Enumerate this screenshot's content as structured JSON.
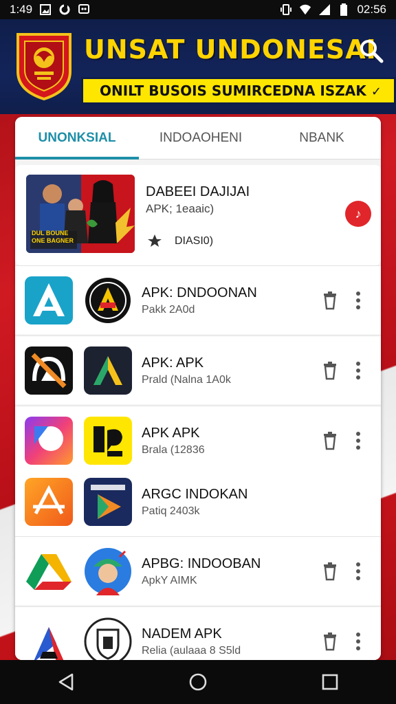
{
  "status_bar": {
    "time_left": "1:49",
    "time_right": "02:56"
  },
  "header": {
    "title": "UNSAT UNDONESAI",
    "banner": "ONILT BUSOIS SUMIRCEDNA ISZAK",
    "banner_check": "✓"
  },
  "tabs": [
    {
      "label": "UNONKSIAL"
    },
    {
      "label": "INDOAOHENI"
    },
    {
      "label": "NBANK"
    }
  ],
  "featured": {
    "title": "DABEEI DAJIJAI",
    "subtitle": "APK; 1eaaic)",
    "tag": "DIASI0)",
    "action_icon": "music-note-icon",
    "image_caption": "DUL BOUNE ONE BAGNER"
  },
  "apps": [
    {
      "title": "APK: DNDOONAN",
      "subtitle": "Pakk 2A0d"
    },
    {
      "title": "APK: APK",
      "subtitle": "Prald (Nalna 1A0k"
    },
    {
      "title": "APK APK",
      "subtitle": "Brala (12836"
    },
    {
      "title": "ARGC INDOKAN",
      "subtitle": "Patiq 2403k"
    },
    {
      "title": "APBG: INDOOBAN",
      "subtitle": "ApkY AIMK"
    },
    {
      "title": "NADEM APK",
      "subtitle": "Relia (aulaaa 8 S5ld"
    }
  ],
  "colors": {
    "accent": "#1e8fa8",
    "header_bg": "#0f1e4a",
    "title_yellow": "#ffd400",
    "banner_yellow": "#ffe600",
    "brand_red": "#d01a22"
  }
}
